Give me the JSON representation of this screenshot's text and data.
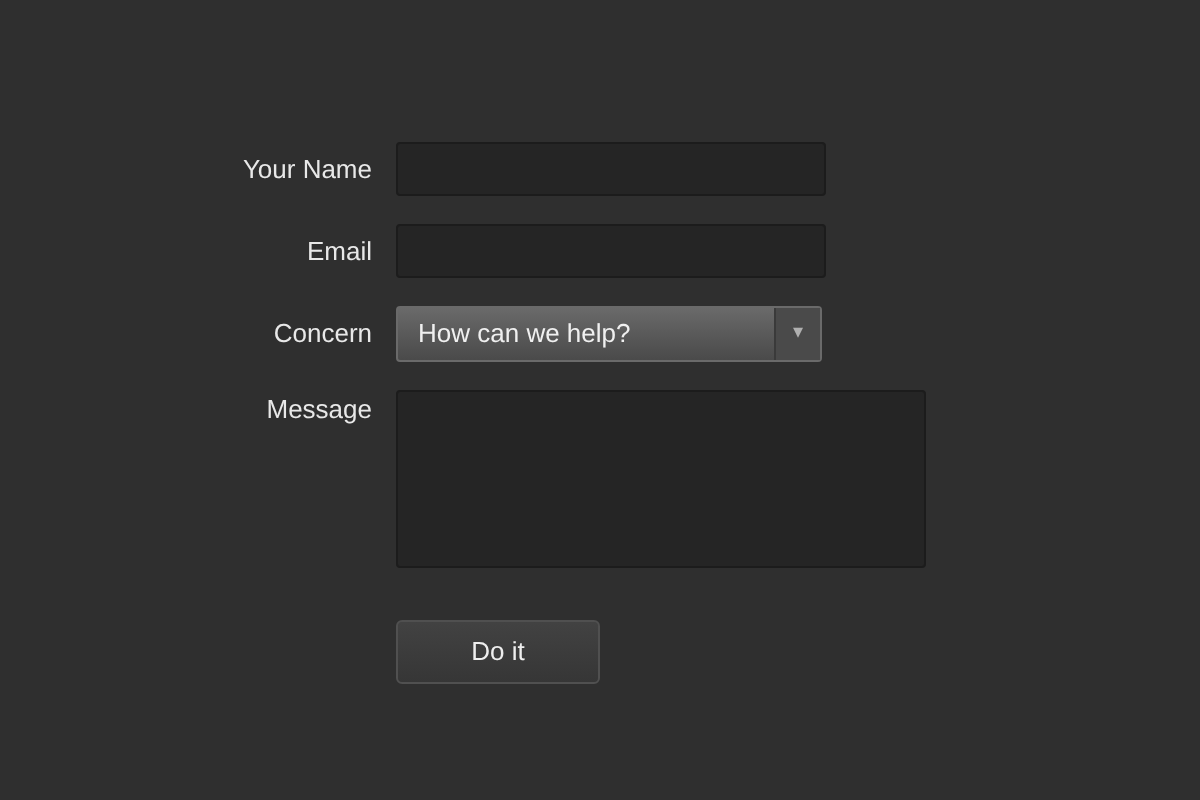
{
  "fields": [
    {
      "kind": "text",
      "label": "Your Name"
    },
    {
      "kind": "text",
      "label": "Email"
    },
    {
      "kind": "select",
      "label": "Concern",
      "value": "How can we help?",
      "arrow": "▾"
    },
    {
      "kind": "textarea",
      "label": "Message"
    }
  ],
  "submit": {
    "label": "Do it"
  }
}
